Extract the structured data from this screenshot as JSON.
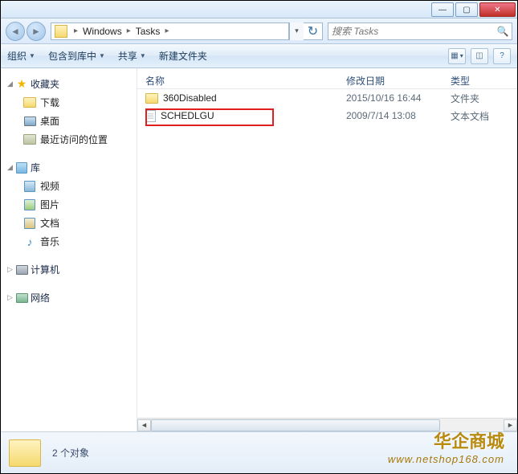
{
  "titlebar": {
    "min": "—",
    "max": "▢",
    "close": "✕"
  },
  "addr": {
    "crumb1": "Windows",
    "crumb2": "Tasks",
    "search_ph": "搜索 Tasks"
  },
  "toolbar": {
    "org": "组织",
    "include": "包含到库中",
    "share": "共享",
    "newfolder": "新建文件夹"
  },
  "nav": {
    "fav": "收藏夹",
    "fav_items": [
      "下载",
      "桌面",
      "最近访问的位置"
    ],
    "lib": "库",
    "lib_items": [
      "视频",
      "图片",
      "文档",
      "音乐"
    ],
    "comp": "计算机",
    "net": "网络"
  },
  "cols": {
    "name": "名称",
    "date": "修改日期",
    "type": "类型"
  },
  "rows": [
    {
      "name": "360Disabled",
      "date": "2015/10/16 16:44",
      "type": "文件夹",
      "kind": "folder"
    },
    {
      "name": "SCHEDLGU",
      "date": "2009/7/14 13:08",
      "type": "文本文档",
      "kind": "txt"
    }
  ],
  "status": {
    "count": "2 个对象"
  },
  "wm": {
    "cn": "华企商城",
    "url": "www.netshop168.com"
  }
}
